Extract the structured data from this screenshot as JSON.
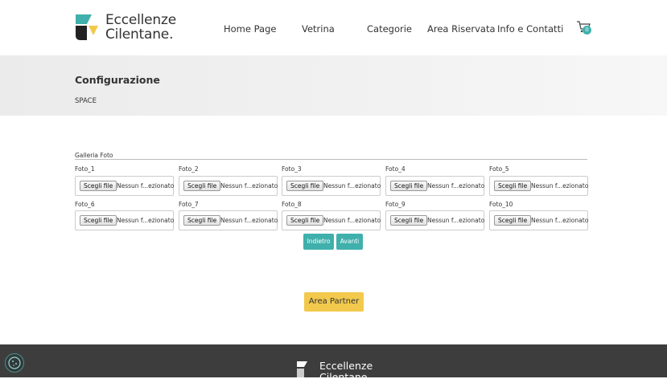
{
  "header": {
    "logo_line1": "Eccellenze",
    "logo_line2": "Cilentane.",
    "nav": [
      "Home Page",
      "Vetrina",
      "Categorie",
      "Area Riservata",
      "Info e Contatti"
    ],
    "cart_count": "0"
  },
  "banner": {
    "title": "Configurazione",
    "subtitle": "SPACE"
  },
  "gallery": {
    "label": "Galleria Foto",
    "button_label": "Scegli file",
    "file_status": "Nessun f...ezionato",
    "fields": [
      "Foto_1",
      "Foto_2",
      "Foto_3",
      "Foto_4",
      "Foto_5",
      "Foto_6",
      "Foto_7",
      "Foto_8",
      "Foto_9",
      "Foto_10"
    ]
  },
  "actions": {
    "prev_label": "Indietro",
    "next_label": "Avanti",
    "partner_label": "Area Partner"
  },
  "footer": {
    "logo_line1": "Eccellenze",
    "logo_line2": "Cilentane."
  },
  "colors": {
    "accent": "#3fb0ac",
    "yellow": "#f2c94c",
    "footer": "#3d3d3d"
  },
  "icons": {
    "cart": "shopping-cart-icon",
    "cookie": "cookie-settings-icon"
  }
}
